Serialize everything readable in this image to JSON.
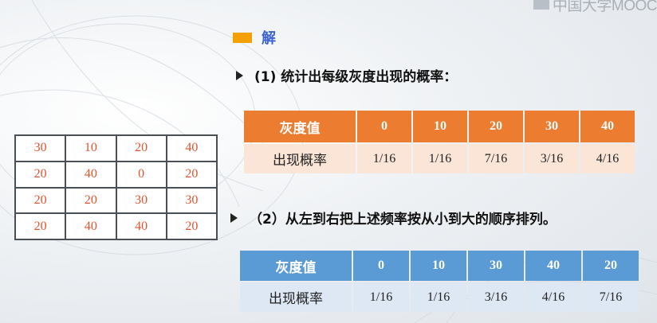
{
  "logo": {
    "text": "中国大学MOOC"
  },
  "heading": {
    "text": "解"
  },
  "step1": {
    "text": "(1) 统计出每级灰度出现的概率："
  },
  "step2": {
    "text": "（2）从左到右把上述频率按从小到大的顺序排列。"
  },
  "image_grid": {
    "rows": [
      [
        "30",
        "10",
        "20",
        "40"
      ],
      [
        "20",
        "40",
        "0",
        "20"
      ],
      [
        "20",
        "20",
        "30",
        "30"
      ],
      [
        "20",
        "40",
        "40",
        "20"
      ]
    ]
  },
  "table1": {
    "header_label": "灰度值",
    "row_label": "出现概率",
    "gray_values": [
      "0",
      "10",
      "20",
      "30",
      "40"
    ],
    "probabilities": [
      "1/16",
      "1/16",
      "7/16",
      "3/16",
      "4/16"
    ]
  },
  "table2": {
    "header_label": "灰度值",
    "row_label": "出现概率",
    "gray_values": [
      "0",
      "10",
      "30",
      "40",
      "20"
    ],
    "probabilities": [
      "1/16",
      "1/16",
      "3/16",
      "4/16",
      "7/16"
    ]
  },
  "colors": {
    "accent_square": "#f4a100",
    "heading": "#3b63d6",
    "table1_header": "#ec7c30",
    "table1_row": "#fbe5d6",
    "table2_header": "#5b9bd5",
    "table2_row": "#dde8f4",
    "grid_text": "#e2532f"
  }
}
